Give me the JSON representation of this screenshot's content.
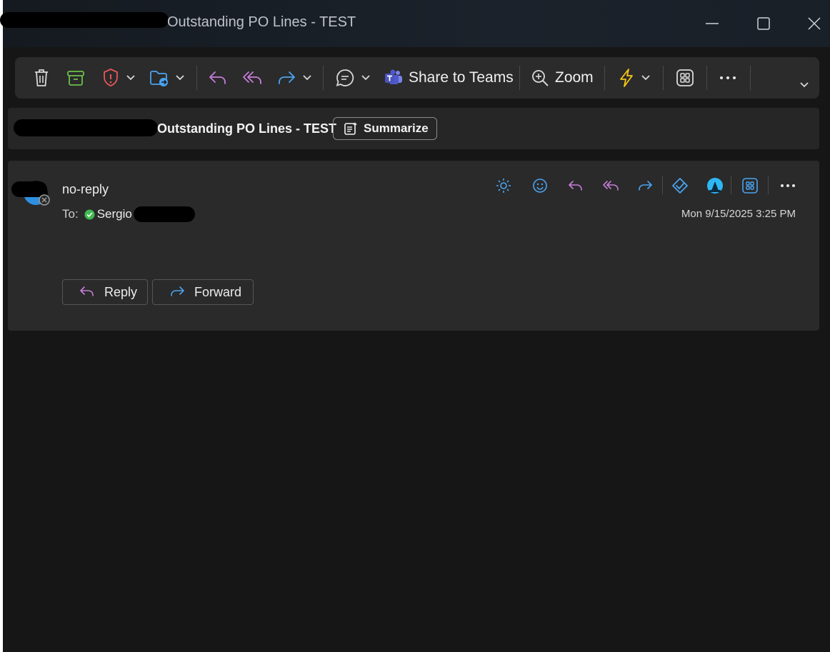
{
  "window": {
    "title": "Outstanding PO Lines - TEST",
    "controls": [
      "minimize-icon",
      "maximize-icon",
      "close-icon"
    ]
  },
  "ribbon": {
    "share_to_teams": "Share to Teams",
    "zoom": "Zoom",
    "icons": [
      "trash-icon",
      "archive-icon",
      "shield-icon",
      "move-folder-icon",
      "reply-icon",
      "reply-all-icon",
      "forward-icon",
      "chat-icon",
      "teams-icon",
      "zoom-icon",
      "lightning-icon",
      "apps-icon",
      "more-icon"
    ]
  },
  "subject": {
    "text": "Outstanding PO Lines - TEST",
    "summarize_label": "Summarize"
  },
  "message": {
    "sender": "no-reply",
    "to_label": "To:",
    "recipient": "Sergio",
    "timestamp": "Mon 9/15/2025 3:25 PM",
    "reply_label": "Reply",
    "forward_label": "Forward"
  },
  "colors": {
    "background": "#161616",
    "panel": "#2a2a2a",
    "reply_purple": "#c77dd8",
    "forward_blue": "#4aa3f0",
    "archive_green": "#6cc04a",
    "shield_red": "#e8575a",
    "lightning_yellow": "#f5c518",
    "presence_green": "#3fb950"
  }
}
